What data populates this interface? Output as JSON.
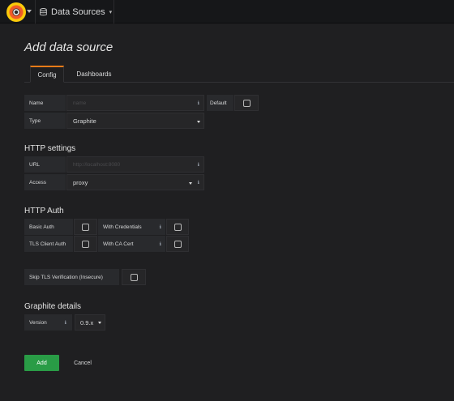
{
  "nav": {
    "logo": "grafana-logo-icon",
    "breadcrumb_label": "Data Sources",
    "breadcrumb_icon": "database-icon"
  },
  "page": {
    "title": "Add data source"
  },
  "tabs": [
    {
      "label": "Config",
      "active": true
    },
    {
      "label": "Dashboards",
      "active": false
    }
  ],
  "general": {
    "name_label": "Name",
    "name_placeholder": "name",
    "default_label": "Default",
    "default_checked": false,
    "type_label": "Type",
    "type_value": "Graphite"
  },
  "http_settings": {
    "title": "HTTP settings",
    "url_label": "URL",
    "url_placeholder": "http://localhost:8080",
    "access_label": "Access",
    "access_value": "proxy"
  },
  "http_auth": {
    "title": "HTTP Auth",
    "basic_auth_label": "Basic Auth",
    "with_credentials_label": "With Credentials",
    "tls_client_auth_label": "TLS Client Auth",
    "with_ca_cert_label": "With CA Cert",
    "skip_tls_label": "Skip TLS Verification (Insecure)"
  },
  "graphite": {
    "title": "Graphite details",
    "version_label": "Version",
    "version_value": "0.9.x"
  },
  "actions": {
    "add_label": "Add",
    "cancel_label": "Cancel"
  },
  "colors": {
    "accent_orange": "#eb7b18",
    "add_green": "#299c46"
  }
}
